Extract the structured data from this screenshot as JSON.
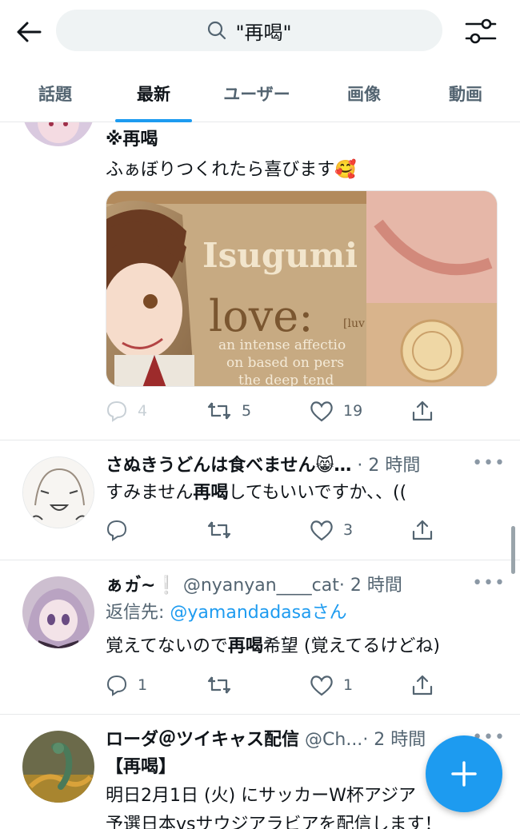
{
  "header": {
    "search_query": "\"再喝\"",
    "back_icon": "arrow-left-icon",
    "filter_icon": "sliders-icon"
  },
  "tabs": [
    {
      "label": "話題",
      "active": false
    },
    {
      "label": "最新",
      "active": true
    },
    {
      "label": "ユーザー",
      "active": false
    },
    {
      "label": "画像",
      "active": false
    },
    {
      "label": "動画",
      "active": false
    }
  ],
  "tweets": [
    {
      "title": "※再喝",
      "text": "ふぁぼりつくれたら喜びます🥰",
      "media": {
        "big_text_1": "Isugumi",
        "big_text_2": "love:",
        "small_text_1": "an intense affectio",
        "small_text_2": "on based on pers",
        "small_text_3": "the deep tend",
        "bracket_text": "[luv"
      },
      "reply_count": "4",
      "retweet_count": "5",
      "like_count": "19"
    },
    {
      "name": "さぬきうどんは食べません😸…",
      "time": "· 2 時間",
      "text_before": "すみません",
      "text_bold": "再喝",
      "text_after": "してもいいですか、、((",
      "reply_count": "",
      "retweet_count": "",
      "like_count": "3"
    },
    {
      "name": "ぁヵ゙~❕",
      "handle": "@nyanyan____cat",
      "time": "· 2 時間",
      "reply_prefix": "返信先: ",
      "reply_to": "@yamandadasa",
      "reply_suffix": "さん",
      "text_before": "覚えてないので",
      "text_bold": "再喝",
      "text_after": "希望 (覚えてるけどね)",
      "reply_count": "1",
      "retweet_count": "",
      "like_count": "1"
    },
    {
      "name": "ローダ＠ツイキャス配信",
      "handle": "@Ch...",
      "time": "· 2 時間",
      "line1": "【再喝】",
      "line2": "明日2月1日 (火) にサッカーW杯アジア",
      "line3": "予選日本vsサウジアラビアを配信します！"
    }
  ],
  "colors": {
    "accent": "#1d9bf0",
    "text": "#0f1419",
    "muted": "#536471",
    "border": "#e7e9ea"
  }
}
